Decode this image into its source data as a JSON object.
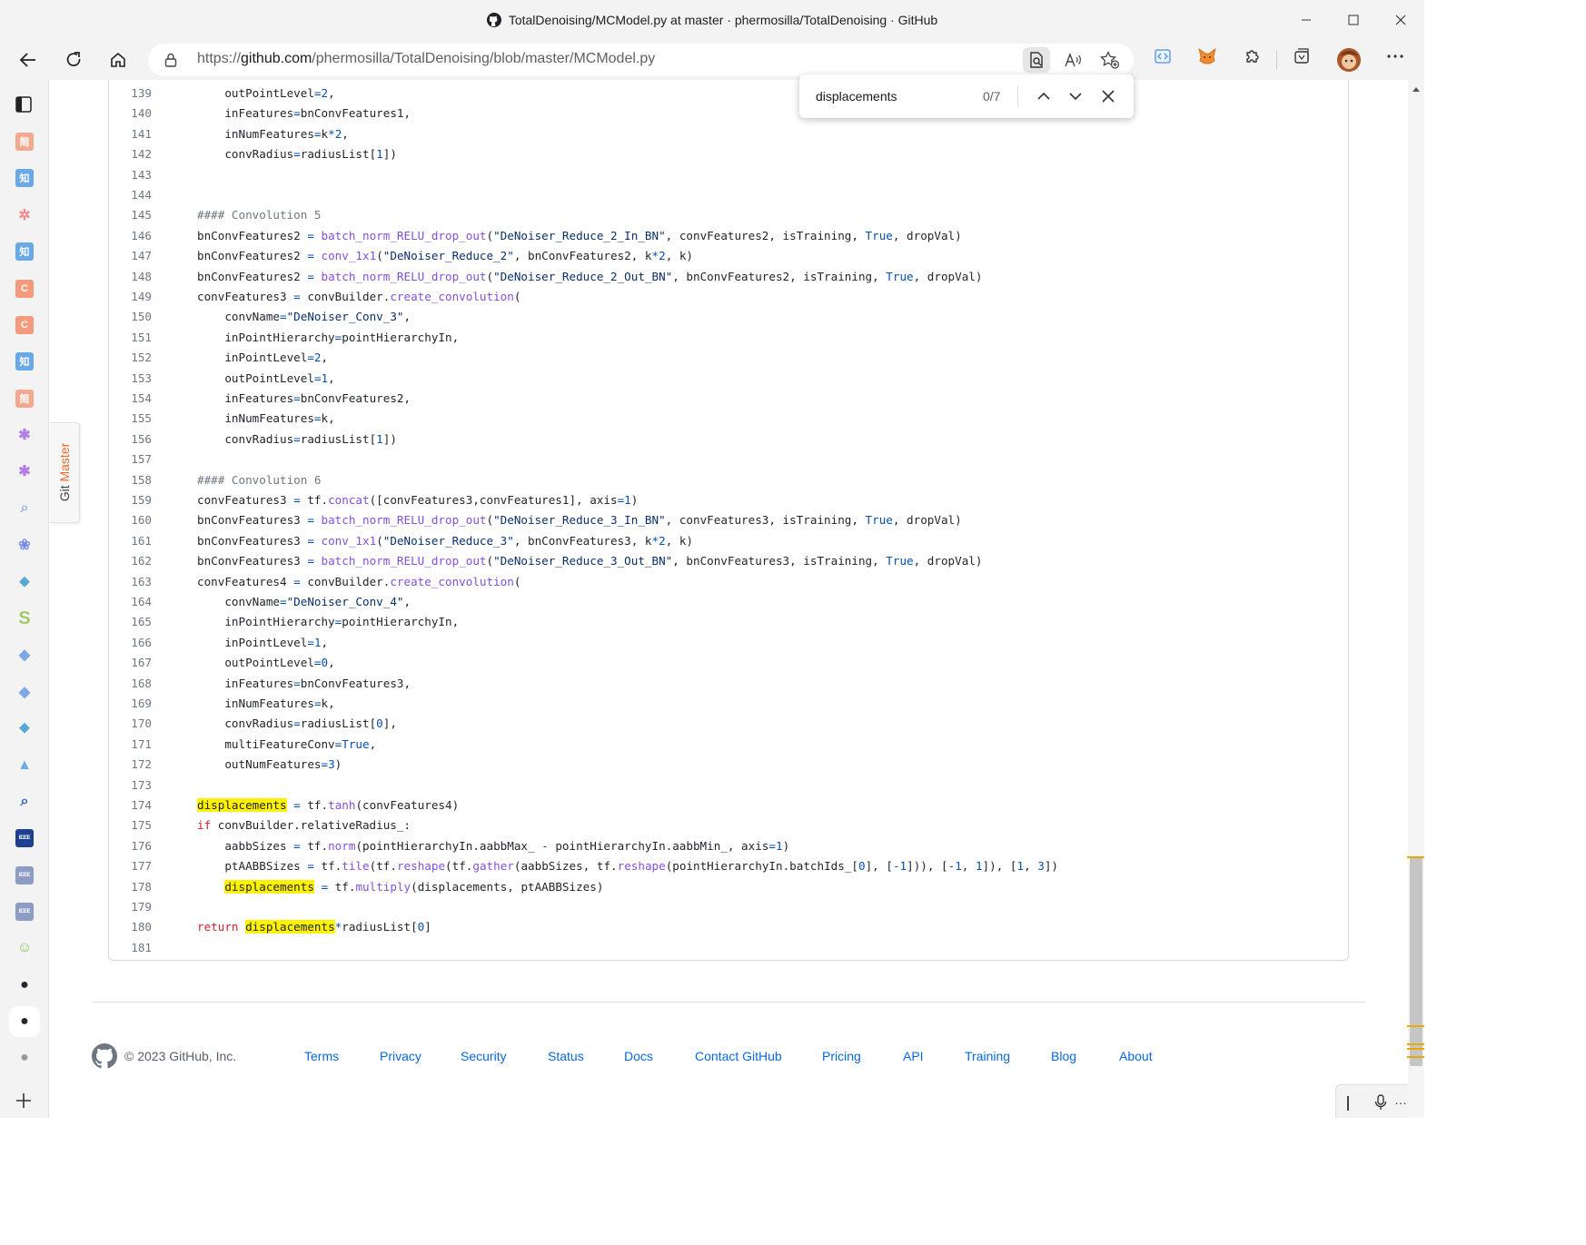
{
  "window": {
    "title": "TotalDenoising/MCModel.py at master · phermosilla/TotalDenoising · GitHub"
  },
  "address_bar": {
    "url_prefix": "https://",
    "url_domain": "github.com",
    "url_path": "/phermosilla/TotalDenoising/blob/master/MCModel.py"
  },
  "find_bar": {
    "query": "displacements",
    "count": "0/7"
  },
  "sidebar": {
    "git_master_label_a": "Git ",
    "git_master_label_b": "Master",
    "items": [
      {
        "icon": "jian-icon",
        "glyph": "简",
        "color": "#f2a98d"
      },
      {
        "icon": "zhi-icon",
        "glyph": "知",
        "color": "#6aa9e8"
      },
      {
        "icon": "atom-icon",
        "glyph": "✲",
        "color": "#f08a8a"
      },
      {
        "icon": "zhi-icon",
        "glyph": "知",
        "color": "#6aa9e8"
      },
      {
        "icon": "c-icon",
        "glyph": "C",
        "color": "#f49a7d"
      },
      {
        "icon": "c-icon",
        "glyph": "C",
        "color": "#f49a7d"
      },
      {
        "icon": "zhi-icon",
        "glyph": "知",
        "color": "#6aa9e8"
      },
      {
        "icon": "jian-icon",
        "glyph": "简",
        "color": "#f2a98d"
      },
      {
        "icon": "asterisk-icon",
        "glyph": "✱",
        "color": "#b57be6"
      },
      {
        "icon": "asterisk-icon",
        "glyph": "✱",
        "color": "#b57be6"
      },
      {
        "icon": "search-icon",
        "glyph": "⌕",
        "color": "#8fb3e0"
      },
      {
        "icon": "paw-icon",
        "glyph": "❀",
        "color": "#7b8ee6"
      },
      {
        "icon": "drop-icon",
        "glyph": "⬥",
        "color": "#5aa7d6"
      },
      {
        "icon": "s-icon",
        "glyph": "S",
        "color": "#a4c96a"
      },
      {
        "icon": "diamond-icon",
        "glyph": "◆",
        "color": "#7fa8e6"
      },
      {
        "icon": "diamond-icon",
        "glyph": "◆",
        "color": "#7fa8e6"
      },
      {
        "icon": "drop-icon",
        "glyph": "⬥",
        "color": "#5aa7d6"
      },
      {
        "icon": "arrow-icon",
        "glyph": "▲",
        "color": "#6aa9e8"
      },
      {
        "icon": "search-icon",
        "glyph": "⌕",
        "color": "#2a5db0"
      },
      {
        "icon": "ieee-icon",
        "glyph": "IEEE",
        "color": "#1d3f8f"
      },
      {
        "icon": "ieee-icon",
        "glyph": "IEEE",
        "color": "#8d9cc4"
      },
      {
        "icon": "ieee-icon",
        "glyph": "IEEE",
        "color": "#8d9cc4"
      },
      {
        "icon": "smile-icon",
        "glyph": "☺",
        "color": "#7cc84f"
      },
      {
        "icon": "github-icon",
        "glyph": "●",
        "color": "#24292f"
      },
      {
        "icon": "github-icon",
        "glyph": "●",
        "color": "#24292f"
      },
      {
        "icon": "github-icon",
        "glyph": "●",
        "color": "#9a9a9a"
      }
    ]
  },
  "code": {
    "lines": [
      {
        "n": "139",
        "html": "    outPointLevel<span class=\"b\">=</span><span class=\"b\">2</span>,"
      },
      {
        "n": "140",
        "html": "    inFeatures<span class=\"b\">=</span>bnConvFeatures1,"
      },
      {
        "n": "141",
        "html": "    inNumFeatures<span class=\"b\">=</span>k<span class=\"b\">*</span><span class=\"b\">2</span>,"
      },
      {
        "n": "142",
        "html": "    convRadius<span class=\"b\">=</span>radiusList[<span class=\"b\">1</span>])"
      },
      {
        "n": "143",
        "html": ""
      },
      {
        "n": "144",
        "html": ""
      },
      {
        "n": "145",
        "html": "<span class=\"c\">#### Convolution 5</span>"
      },
      {
        "n": "146",
        "html": "bnConvFeatures2 <span class=\"b\">=</span> <span class=\"f\">batch_norm_RELU_drop_out</span>(<span class=\"s\">\"DeNoiser_Reduce_2_In_BN\"</span>, convFeatures2, isTraining, <span class=\"b\">True</span>, dropVal)"
      },
      {
        "n": "147",
        "html": "bnConvFeatures2 <span class=\"b\">=</span> <span class=\"f\">conv_1x1</span>(<span class=\"s\">\"DeNoiser_Reduce_2\"</span>, bnConvFeatures2, k<span class=\"b\">*</span><span class=\"b\">2</span>, k)"
      },
      {
        "n": "148",
        "html": "bnConvFeatures2 <span class=\"b\">=</span> <span class=\"f\">batch_norm_RELU_drop_out</span>(<span class=\"s\">\"DeNoiser_Reduce_2_Out_BN\"</span>, bnConvFeatures2, isTraining, <span class=\"b\">True</span>, dropVal)"
      },
      {
        "n": "149",
        "html": "convFeatures3 <span class=\"b\">=</span> convBuilder.<span class=\"f\">create_convolution</span>("
      },
      {
        "n": "150",
        "html": "    convName<span class=\"b\">=</span><span class=\"s\">\"DeNoiser_Conv_3\"</span>,"
      },
      {
        "n": "151",
        "html": "    inPointHierarchy<span class=\"b\">=</span>pointHierarchyIn,"
      },
      {
        "n": "152",
        "html": "    inPointLevel<span class=\"b\">=</span><span class=\"b\">2</span>,"
      },
      {
        "n": "153",
        "html": "    outPointLevel<span class=\"b\">=</span><span class=\"b\">1</span>,"
      },
      {
        "n": "154",
        "html": "    inFeatures<span class=\"b\">=</span>bnConvFeatures2,"
      },
      {
        "n": "155",
        "html": "    inNumFeatures<span class=\"b\">=</span>k,"
      },
      {
        "n": "156",
        "html": "    convRadius<span class=\"b\">=</span>radiusList[<span class=\"b\">1</span>])"
      },
      {
        "n": "157",
        "html": ""
      },
      {
        "n": "158",
        "html": "<span class=\"c\">#### Convolution 6</span>"
      },
      {
        "n": "159",
        "html": "convFeatures3 <span class=\"b\">=</span> tf.<span class=\"f\">concat</span>([convFeatures3,convFeatures1], axis<span class=\"b\">=</span><span class=\"b\">1</span>)"
      },
      {
        "n": "160",
        "html": "bnConvFeatures3 <span class=\"b\">=</span> <span class=\"f\">batch_norm_RELU_drop_out</span>(<span class=\"s\">\"DeNoiser_Reduce_3_In_BN\"</span>, convFeatures3, isTraining, <span class=\"b\">True</span>, dropVal)"
      },
      {
        "n": "161",
        "html": "bnConvFeatures3 <span class=\"b\">=</span> <span class=\"f\">conv_1x1</span>(<span class=\"s\">\"DeNoiser_Reduce_3\"</span>, bnConvFeatures3, k<span class=\"b\">*</span><span class=\"b\">2</span>, k)"
      },
      {
        "n": "162",
        "html": "bnConvFeatures3 <span class=\"b\">=</span> <span class=\"f\">batch_norm_RELU_drop_out</span>(<span class=\"s\">\"DeNoiser_Reduce_3_Out_BN\"</span>, bnConvFeatures3, isTraining, <span class=\"b\">True</span>, dropVal)"
      },
      {
        "n": "163",
        "html": "convFeatures4 <span class=\"b\">=</span> convBuilder.<span class=\"f\">create_convolution</span>("
      },
      {
        "n": "164",
        "html": "    convName<span class=\"b\">=</span><span class=\"s\">\"DeNoiser_Conv_4\"</span>,"
      },
      {
        "n": "165",
        "html": "    inPointHierarchy<span class=\"b\">=</span>pointHierarchyIn,"
      },
      {
        "n": "166",
        "html": "    inPointLevel<span class=\"b\">=</span><span class=\"b\">1</span>,"
      },
      {
        "n": "167",
        "html": "    outPointLevel<span class=\"b\">=</span><span class=\"b\">0</span>,"
      },
      {
        "n": "168",
        "html": "    inFeatures<span class=\"b\">=</span>bnConvFeatures3,"
      },
      {
        "n": "169",
        "html": "    inNumFeatures<span class=\"b\">=</span>k,"
      },
      {
        "n": "170",
        "html": "    convRadius<span class=\"b\">=</span>radiusList[<span class=\"b\">0</span>],"
      },
      {
        "n": "171",
        "html": "    multiFeatureConv<span class=\"b\">=</span><span class=\"b\">True</span>,"
      },
      {
        "n": "172",
        "html": "    outNumFeatures<span class=\"b\">=</span><span class=\"b\">3</span>)"
      },
      {
        "n": "173",
        "html": ""
      },
      {
        "n": "174",
        "html": "<span class=\"hl\">displacements</span> <span class=\"b\">=</span> tf.<span class=\"f\">tanh</span>(convFeatures4)"
      },
      {
        "n": "175",
        "html": "<span class=\"k\">if</span> convBuilder.relativeRadius_:"
      },
      {
        "n": "176",
        "html": "    aabbSizes <span class=\"b\">=</span> tf.<span class=\"f\">norm</span>(pointHierarchyIn.aabbMax_ <span class=\"b\">-</span> pointHierarchyIn.aabbMin_, axis<span class=\"b\">=</span><span class=\"b\">1</span>)"
      },
      {
        "n": "177",
        "html": "    ptAABBSizes <span class=\"b\">=</span> tf.<span class=\"f\">tile</span>(tf.<span class=\"f\">reshape</span>(tf.<span class=\"f\">gather</span>(aabbSizes, tf.<span class=\"f\">reshape</span>(pointHierarchyIn.batchIds_[<span class=\"b\">0</span>], [<span class=\"b\">-1</span>])), [<span class=\"b\">-1</span>, <span class=\"b\">1</span>]), [<span class=\"b\">1</span>, <span class=\"b\">3</span>])"
      },
      {
        "n": "178",
        "html": "    <span class=\"hl\">displacements</span> <span class=\"b\">=</span> tf.<span class=\"f\">multiply</span>(displacements, ptAABBSizes)"
      },
      {
        "n": "179",
        "html": ""
      },
      {
        "n": "180",
        "html": "<span class=\"k\">return</span> <span class=\"hl\">displacements</span><span class=\"b\">*</span>radiusList[<span class=\"b\">0</span>]"
      },
      {
        "n": "181",
        "html": ""
      }
    ]
  },
  "footer": {
    "copyright": "© 2023 GitHub, Inc.",
    "links": [
      "Terms",
      "Privacy",
      "Security",
      "Status",
      "Docs",
      "Contact GitHub",
      "Pricing",
      "API",
      "Training",
      "Blog",
      "About"
    ]
  },
  "colors": {
    "link": "#0969da",
    "highlight": "#fff200",
    "find_match_mark": "#e8a900"
  }
}
